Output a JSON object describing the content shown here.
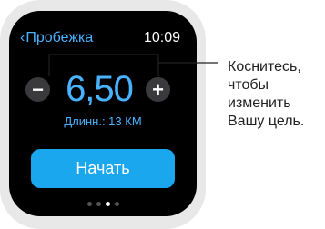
{
  "header": {
    "back_label": "Пробежка",
    "back_chevron": "‹",
    "time": "10:09"
  },
  "goal": {
    "value": "6,50",
    "minus_label": "−",
    "plus_label": "+",
    "subtitle": "Длинн.: 13 КМ"
  },
  "actions": {
    "start_label": "Начать"
  },
  "pagination": {
    "total": 4,
    "active_index": 2
  },
  "callout": {
    "lines": [
      "Коснитесь,",
      "чтобы",
      "изменить",
      "Вашу цель."
    ]
  },
  "colors": {
    "accent": "#4ab3ff",
    "button": "#1aa7ee",
    "screen": "#000000",
    "bezel": "#e8e8e8"
  },
  "icons": {
    "back": "chevron-left-icon",
    "minus": "minus-icon",
    "plus": "plus-icon"
  }
}
